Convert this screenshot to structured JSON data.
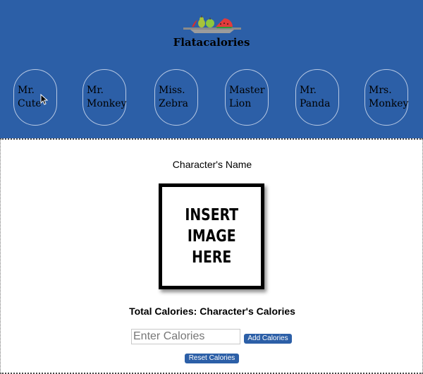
{
  "header": {
    "brand": "Flatacalories",
    "logo_icon": "fruit-platter-icon",
    "background": "#2c5fa7"
  },
  "characters": [
    {
      "name": "Mr. Cute"
    },
    {
      "name": "Mr. Monkey"
    },
    {
      "name": "Miss. Zebra"
    },
    {
      "name": "Master Lion"
    },
    {
      "name": "Mr. Panda"
    },
    {
      "name": "Mrs. Monkey"
    }
  ],
  "detail": {
    "name": "Character's Name",
    "image_placeholder": "INSERT\nIMAGE\nHERE",
    "total_label": "Total Calories:",
    "total_value": "Character's Calories"
  },
  "form": {
    "input_placeholder": "Enter Calories",
    "add_label": "Add Calories",
    "reset_label": "Reset Calories"
  },
  "colors": {
    "accent": "#2c5fa7",
    "oval_border": "#b8c9e4"
  }
}
